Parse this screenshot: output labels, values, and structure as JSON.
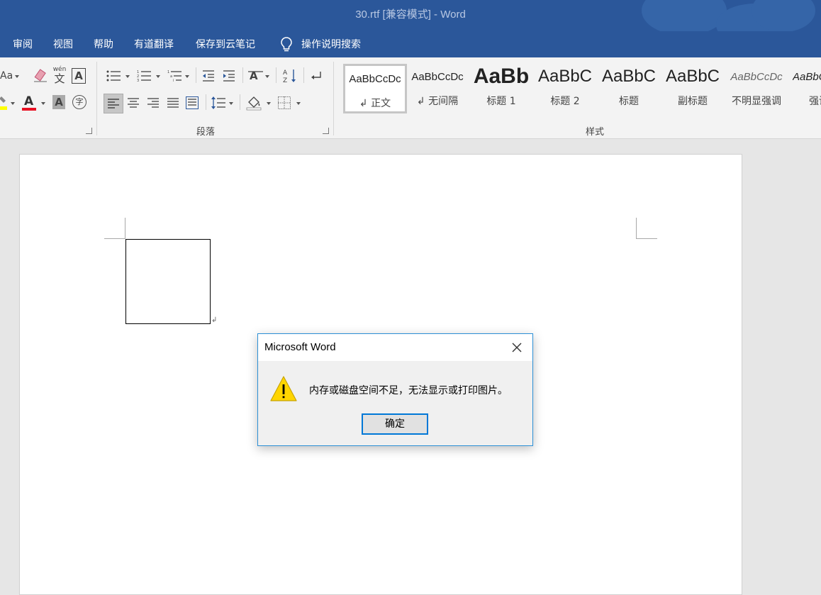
{
  "window": {
    "title": "30.rtf [兼容模式]  -  Word"
  },
  "menu": {
    "items": [
      "审阅",
      "视图",
      "帮助",
      "有道翻译",
      "保存到云笔记"
    ],
    "search_label": "操作说明搜索"
  },
  "ribbon": {
    "paragraph_label": "段落",
    "styles_label": "样式",
    "font_glyphs": {
      "case": "Aa",
      "phonetic_top": "wén",
      "phonetic_bottom": "文",
      "border": "A",
      "font_color": "A",
      "shading": "A",
      "enclose": "字"
    },
    "styles": [
      {
        "preview": "AaBbCcDc",
        "name": "↲ 正文"
      },
      {
        "preview": "AaBbCcDc",
        "name": "↲ 无间隔"
      },
      {
        "preview": "AaBb",
        "name": "标题 1"
      },
      {
        "preview": "AaBbC",
        "name": "标题 2"
      },
      {
        "preview": "AaBbC",
        "name": "标题"
      },
      {
        "preview": "AaBbC",
        "name": "副标题"
      },
      {
        "preview": "AaBbCcDc",
        "name": "不明显强调"
      },
      {
        "preview": "AaBbCcDc",
        "name": "强调"
      }
    ]
  },
  "document": {
    "paragraph_mark": "↲"
  },
  "dialog": {
    "title": "Microsoft Word",
    "message": "内存或磁盘空间不足，无法显示或打印图片。",
    "ok_label": "确定"
  },
  "colors": {
    "accent": "#2b579a",
    "dialog_border": "#2b8fd6",
    "font_color_bar": "#e81123",
    "highlight_bar": "#ffff00"
  }
}
